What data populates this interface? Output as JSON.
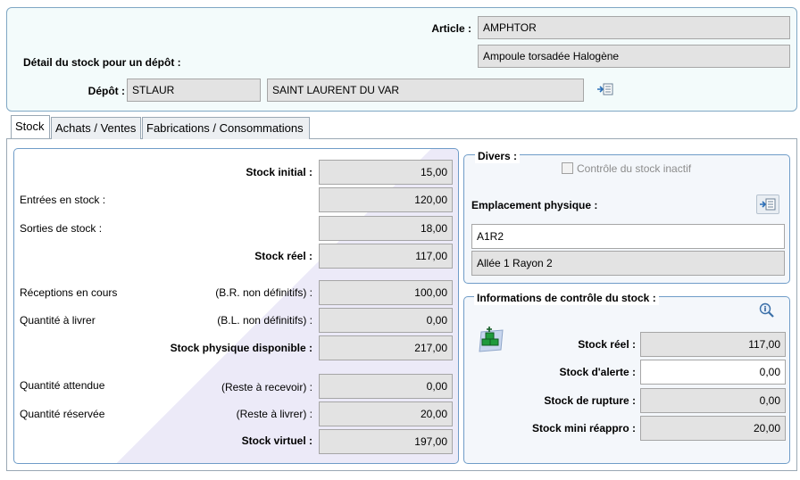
{
  "header": {
    "article_label": "Article :",
    "article_code": "AMPHTOR",
    "article_desc": "Ampoule torsadée Halogène",
    "section_title": "Détail du stock pour un dépôt :",
    "depot_label": "Dépôt :",
    "depot_code": "STLAUR",
    "depot_name": "SAINT LAURENT DU VAR",
    "depot_lookup_icon": "list-arrow-icon"
  },
  "tabs": [
    {
      "label": "Stock",
      "active": true
    },
    {
      "label": "Achats / Ventes",
      "active": false
    },
    {
      "label": "Fabrications / Consommations",
      "active": false
    }
  ],
  "stock": {
    "stock_initial_label": "Stock initial :",
    "stock_initial": "15,00",
    "entrees_label": "Entrées en stock :",
    "entrees": "120,00",
    "sorties_label": "Sorties de stock :",
    "sorties": "18,00",
    "stock_reel_label": "Stock réel :",
    "stock_reel": "117,00",
    "receptions_label": "Réceptions en cours",
    "receptions_note": "(B.R. non définitifs) :",
    "receptions": "100,00",
    "a_livrer_label": "Quantité à livrer",
    "a_livrer_note": "(B.L. non définitifs) :",
    "a_livrer": "0,00",
    "physique_label": "Stock physique disponible :",
    "physique": "217,00",
    "attendue_label": "Quantité attendue",
    "attendue_note": "(Reste à recevoir) :",
    "attendue": "0,00",
    "reservee_label": "Quantité réservée",
    "reservee_note": "(Reste à livrer) :",
    "reservee": "20,00",
    "virtuel_label": "Stock virtuel :",
    "virtuel": "197,00"
  },
  "divers": {
    "title": "Divers :",
    "checkbox_label": "Contrôle du stock inactif",
    "checkbox_checked": false,
    "emplacement_label": "Emplacement physique :",
    "emplacement_code": "A1R2",
    "emplacement_desc": "Allée 1 Rayon 2",
    "lookup_icon": "list-arrow-icon"
  },
  "controle": {
    "title": "Informations de contrôle du stock :",
    "zoom_icon": "magnifier-info-icon",
    "stock_icon": "warehouse-stock-icon",
    "stock_reel_label": "Stock réel :",
    "stock_reel": "117,00",
    "alerte_label": "Stock d'alerte :",
    "alerte": "0,00",
    "rupture_label": "Stock de rupture :",
    "rupture": "0,00",
    "mini_label": "Stock mini réappro :",
    "mini": "20,00"
  },
  "colors": {
    "group_border": "#6f9cc8",
    "field_bg": "#e3e3e3",
    "panel_bg": "#f3fbfb"
  }
}
